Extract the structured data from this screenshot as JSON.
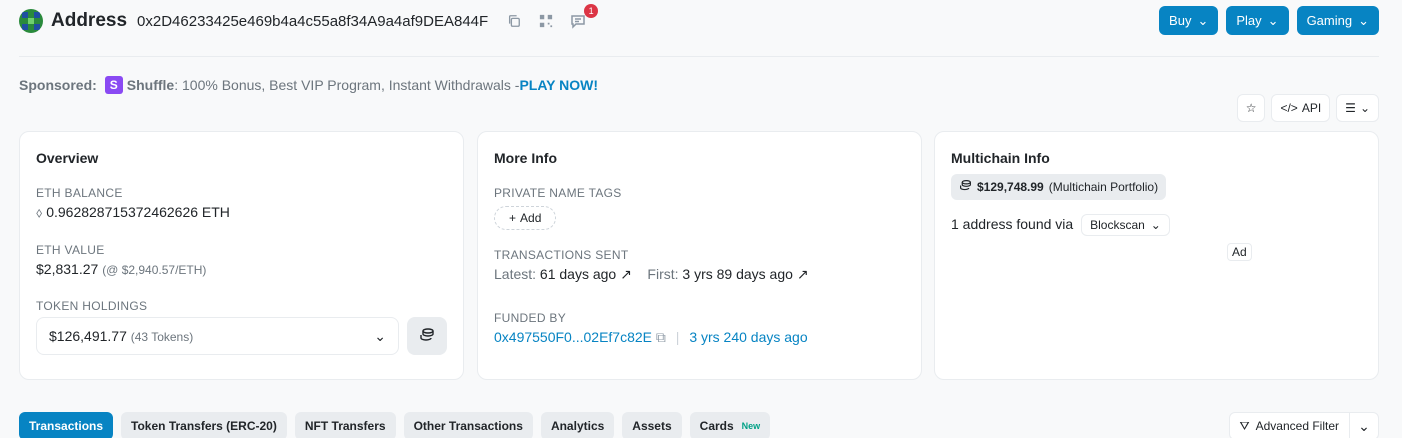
{
  "header": {
    "label": "Address",
    "address": "0x2D46233425e469b4a4c55a8f34A9a4af9DEA844F",
    "notif_count": "1"
  },
  "top_buttons": [
    {
      "label": "Buy"
    },
    {
      "label": "Play"
    },
    {
      "label": "Gaming"
    }
  ],
  "sponsored": {
    "prefix": "Sponsored:",
    "brand": "Shuffle",
    "text": ": 100% Bonus, Best VIP Program, Instant Withdrawals - ",
    "cta": "PLAY NOW!"
  },
  "toolbar": {
    "api_label": "API"
  },
  "overview": {
    "title": "Overview",
    "eth_balance_label": "ETH BALANCE",
    "eth_balance": "0.962828715372462626 ETH",
    "eth_value_label": "ETH VALUE",
    "eth_value": "$2,831.27",
    "eth_price": "(@ $2,940.57/ETH)",
    "token_holdings_label": "TOKEN HOLDINGS",
    "token_value": "$126,491.77",
    "token_count": "(43 Tokens)"
  },
  "more_info": {
    "title": "More Info",
    "private_tags_label": "PRIVATE NAME TAGS",
    "add_label": "Add",
    "tx_sent_label": "TRANSACTIONS SENT",
    "latest_prefix": "Latest:",
    "latest_value": "61 days ago",
    "first_prefix": "First:",
    "first_value": "3 yrs 89 days ago",
    "funded_by_label": "FUNDED BY",
    "funded_by_addr": "0x497550F0...02Ef7c82E",
    "funded_by_age": "3 yrs 240 days ago"
  },
  "multichain": {
    "title": "Multichain Info",
    "portfolio_value": "$129,748.99",
    "portfolio_label": "(Multichain Portfolio)",
    "found_text": "1 address found via",
    "source": "Blockscan",
    "ad_label": "Ad"
  },
  "tabs": [
    {
      "label": "Transactions",
      "active": true
    },
    {
      "label": "Token Transfers (ERC-20)"
    },
    {
      "label": "NFT Transfers"
    },
    {
      "label": "Other Transactions"
    },
    {
      "label": "Analytics"
    },
    {
      "label": "Assets"
    },
    {
      "label": "Cards",
      "badge": "New"
    }
  ],
  "advanced_filter_label": "Advanced Filter",
  "colors": {
    "accent": "#0784c3",
    "danger": "#dc3545",
    "brand_shuffle": "#8a4af3"
  }
}
